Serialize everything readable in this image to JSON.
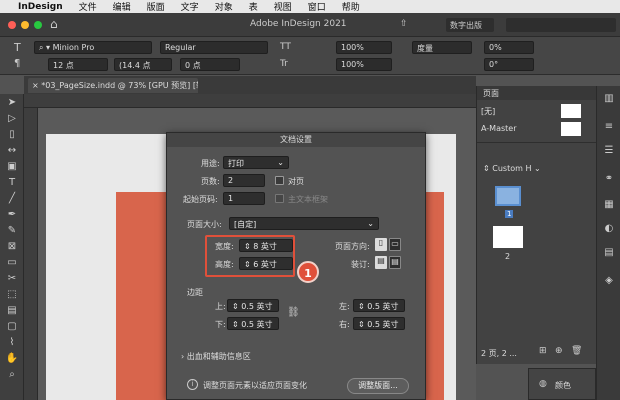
{
  "menubar": {
    "apple": "",
    "app": "InDesign",
    "items": [
      "文件",
      "编辑",
      "版面",
      "文字",
      "对象",
      "表",
      "视图",
      "窗口",
      "帮助"
    ]
  },
  "titlebar": {
    "title": "Adobe InDesign 2021",
    "workspace": "数字出版",
    "home": "⌂"
  },
  "control": {
    "font": "Minion Pro",
    "style": "Regular",
    "size": "12 点",
    "leading": "(14.4 点",
    "scale1": "100%",
    "scale2": "100%",
    "kerning": "度量",
    "tracking": "0%",
    "baseline": "0 点",
    "skew": "0°",
    "cap": "TT",
    "tt2": "Tr"
  },
  "document_tab": {
    "label": "*03_PageSize.indd @ 73% [GPU 预览] [转换]"
  },
  "dialog": {
    "title": "文档设置",
    "intent_label": "用途:",
    "intent_value": "打印",
    "pages_label": "页数:",
    "pages_value": "2",
    "facing_label": "对页",
    "start_label": "起始页码:",
    "start_value": "1",
    "primary_label": "主文本框架",
    "size_label": "页面大小:",
    "size_value": "[自定]",
    "width_label": "宽度:",
    "width_value": "8 英寸",
    "height_label": "高度:",
    "height_value": "6 英寸",
    "orient_label": "页面方向:",
    "binding_label": "装订:",
    "margins_label": "边距",
    "top_label": "上:",
    "top_value": "0.5 英寸",
    "bottom_label": "下:",
    "bottom_value": "0.5 英寸",
    "left_label": "左:",
    "left_value": "0.5 英寸",
    "right_label": "右:",
    "right_value": "0.5 英寸",
    "bleed_label": "出血和辅助信息区",
    "adjust_label": "调整页面元素以适应页面变化",
    "adjust_button": "调整版面..."
  },
  "callout": {
    "number": "1"
  },
  "pages_panel": {
    "tab": "页面",
    "none_label": "[无]",
    "master_label": "A-Master",
    "size_label": "Custom H",
    "page1": "1",
    "page2": "2",
    "footer": "2 页, 2 ..."
  },
  "color_panel": {
    "label": "颜色"
  }
}
